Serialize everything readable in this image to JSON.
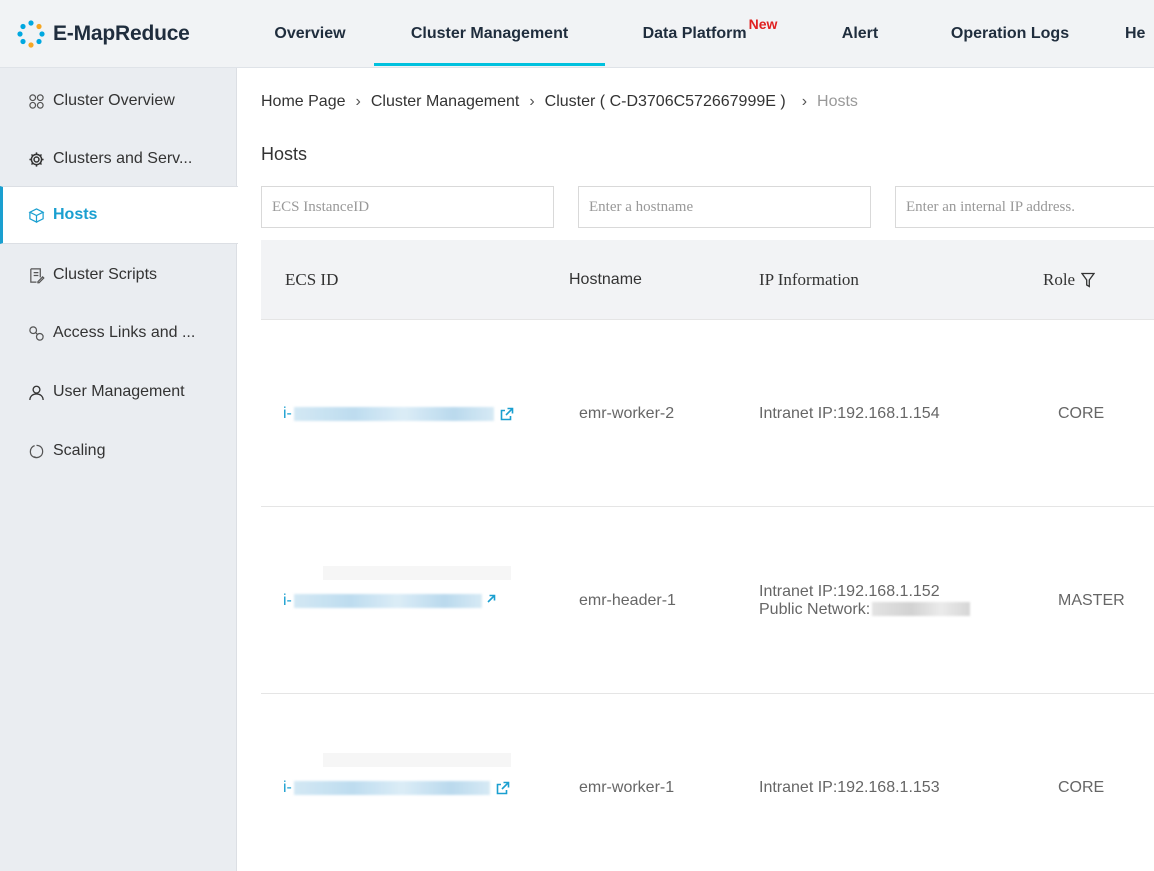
{
  "brand": {
    "name": "E-MapReduce"
  },
  "nav": {
    "tabs": [
      {
        "label": "Overview"
      },
      {
        "label": "Cluster Management"
      },
      {
        "label": "Data Platform",
        "badge": "New"
      },
      {
        "label": "Alert"
      },
      {
        "label": "Operation Logs"
      },
      {
        "label": "He"
      }
    ]
  },
  "sidebar": {
    "items": [
      {
        "label": "Cluster Overview",
        "icon": "cluster-overview-icon"
      },
      {
        "label": "Clusters and Serv...",
        "icon": "gear-icon"
      },
      {
        "label": "Hosts",
        "icon": "host-icon"
      },
      {
        "label": "Cluster Scripts",
        "icon": "script-icon"
      },
      {
        "label": "Access Links and ...",
        "icon": "link-icon"
      },
      {
        "label": "User Management",
        "icon": "user-icon"
      },
      {
        "label": "Scaling",
        "icon": "scaling-icon"
      }
    ]
  },
  "breadcrumb": {
    "items": [
      "Home Page",
      "Cluster Management",
      "Cluster ( C-D3706C572667999E )"
    ],
    "current": "Hosts",
    "separator": "›"
  },
  "page": {
    "title": "Hosts"
  },
  "filters": {
    "ecs_placeholder": "ECS InstanceID",
    "hostname_placeholder": "Enter a hostname",
    "ip_placeholder": "Enter an internal IP address."
  },
  "table": {
    "headers": {
      "ecs_id": "ECS ID",
      "hostname": "Hostname",
      "ip": "IP Information",
      "role": "Role"
    },
    "rows": [
      {
        "ecs_prefix": "i-",
        "hostname": "emr-worker-2",
        "intranet_ip": "Intranet IP:192.168.1.154",
        "public_network": "",
        "role": "CORE"
      },
      {
        "ecs_prefix": "i-",
        "hostname": "emr-header-1",
        "intranet_ip": "Intranet IP:192.168.1.152",
        "public_network": "Public Network:",
        "role": "MASTER"
      },
      {
        "ecs_prefix": "i-",
        "hostname": "emr-worker-1",
        "intranet_ip": "Intranet IP:192.168.1.153",
        "public_network": "",
        "role": "CORE"
      }
    ]
  },
  "colors": {
    "accent": "#00c1de",
    "link": "#1a9fd0",
    "badge": "#e02020"
  }
}
